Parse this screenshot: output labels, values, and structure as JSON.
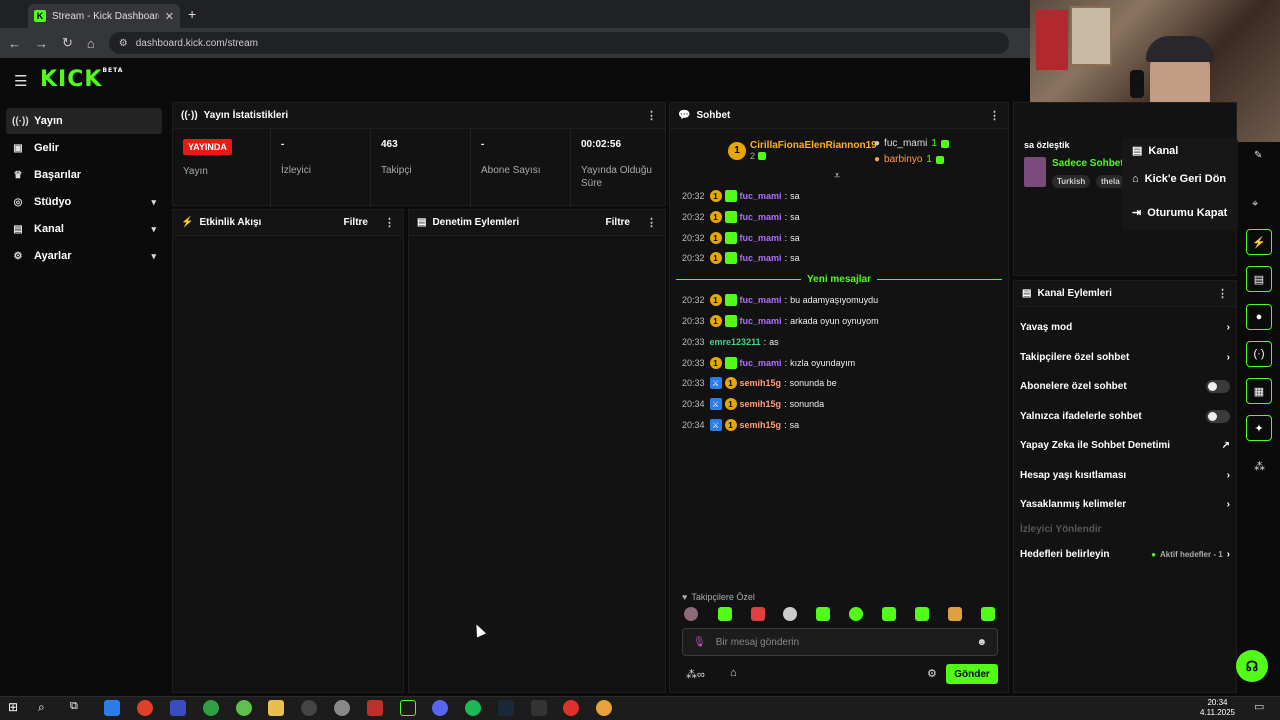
{
  "browser": {
    "tab_title": "Stream - Kick Dashboard",
    "url": "dashboard.kick.com/stream"
  },
  "app": {
    "logo": "KICK",
    "logo_tag": "BETA"
  },
  "sidebar": {
    "items": [
      {
        "label": "Yayın",
        "icon": "broadcast-icon"
      },
      {
        "label": "Gelir",
        "icon": "revenue-icon"
      },
      {
        "label": "Başarılar",
        "icon": "trophy-icon"
      },
      {
        "label": "Stüdyo",
        "icon": "studio-icon"
      },
      {
        "label": "Kanal",
        "icon": "channel-icon"
      },
      {
        "label": "Ayarlar",
        "icon": "gear-icon"
      }
    ]
  },
  "stats": {
    "title": "Yayın İstatistikleri",
    "status_badge": "YAYINDA",
    "status_label": "Yayın",
    "viewers_value": "-",
    "viewers_label": "İzleyici",
    "followers_value": "463",
    "followers_label": "Takipçi",
    "subs_value": "-",
    "subs_label": "Abone Sayısı",
    "uptime_value": "00:02:56",
    "uptime_label": "Yayında Olduğu Süre"
  },
  "activity": {
    "title": "Etkinlik Akışı",
    "filter": "Filtre"
  },
  "moderation": {
    "title": "Denetim Eylemleri",
    "filter": "Filtre"
  },
  "chat": {
    "title": "Sohbet",
    "pinned_user": "CirillaFionaElenRiannon19",
    "pinned_count": "2",
    "top_users": [
      {
        "name": "fuc_mami",
        "count": "1"
      },
      {
        "name": "barbinyo",
        "count": "1"
      }
    ],
    "new_messages": "Yeni mesajlar",
    "messages": [
      {
        "time": "20:32",
        "user": "fuc_mami",
        "text": "sa"
      },
      {
        "time": "20:32",
        "user": "fuc_mami",
        "text": "sa"
      },
      {
        "time": "20:32",
        "user": "fuc_mami",
        "text": "sa"
      },
      {
        "time": "20:32",
        "user": "fuc_mami",
        "text": "sa"
      },
      {
        "time": "20:32",
        "user": "fuc_mami",
        "text": "bu adamyaşıyomuydu"
      },
      {
        "time": "20:33",
        "user": "fuc_mami",
        "text": "arkada oyun oynuyom"
      },
      {
        "time": "20:33",
        "user": "emre123211",
        "text": "as"
      },
      {
        "time": "20:33",
        "user": "fuc_mami",
        "text": "kızla oyundayım"
      },
      {
        "time": "20:33",
        "user": "semih15g",
        "text": "sonunda be"
      },
      {
        "time": "20:34",
        "user": "semih15g",
        "text": "sonunda"
      },
      {
        "time": "20:34",
        "user": "semih15g",
        "text": "sa"
      }
    ],
    "followers_only": "Takipçilere Özel",
    "input_placeholder": "Bir mesaj gönderin",
    "send": "Gönder"
  },
  "channel_actions": {
    "title": "Kanal Eylemleri",
    "items": [
      {
        "label": "Yavaş mod"
      },
      {
        "label": "Takipçilere özel sohbet"
      },
      {
        "label": "Abonelere özel sohbet"
      },
      {
        "label": "Yalnızca ifadelerle sohbet"
      },
      {
        "label": "Yapay Zeka ile Sohbet Denetimi"
      },
      {
        "label": "Hesap yaşı kısıtlaması"
      },
      {
        "label": "Yasaklanmış kelimeler"
      },
      {
        "label": "İzleyici Yönlendir"
      },
      {
        "label": "Hedefleri belirleyin"
      }
    ],
    "goals_status": "Aktif hedefler - 1"
  },
  "stream_info": {
    "title_partial": "sa özleştik",
    "category": "Sadece Sohbet",
    "tags": [
      "Turkish",
      "thela"
    ]
  },
  "dropdown": {
    "items": [
      "Kanal",
      "Kick'e Geri Dön",
      "Oturumu Kapat"
    ]
  },
  "taskbar": {
    "time": "20:34",
    "date": "4.11.2025"
  },
  "colors": {
    "accent": "#53fc18",
    "live": "#e91916",
    "panel": "#121212"
  }
}
